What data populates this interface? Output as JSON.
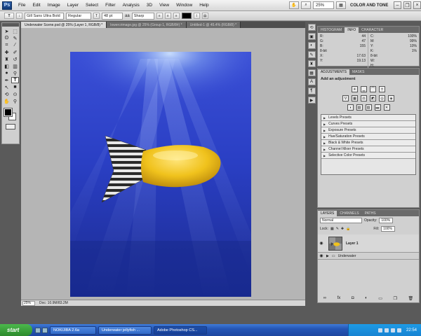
{
  "menubar": {
    "logo": "Ps",
    "items": [
      "File",
      "Edit",
      "Image",
      "Layer",
      "Select",
      "Filter",
      "Analysis",
      "3D",
      "View",
      "Window",
      "Help"
    ],
    "zoom": "25%",
    "workspace": "COLOR AND TONE"
  },
  "options": {
    "tool_icon": "T",
    "font_family": "Gill Sans Ultra Bold",
    "font_style": "Regular",
    "font_size": "48 pt",
    "aa_label": "aa",
    "antialias": "Sharp"
  },
  "tabs": [
    "Underwater Scene.psd @ 25% (Layer 1, RGB/8) *",
    "lowercrimage.jpg @ 25% (Group 1, RGB/8#) *",
    "Untitled-1 @ 45.4% (RGB/8) *"
  ],
  "status": {
    "zoom": "25%",
    "doc": "Doc: 10.9M/83.2M"
  },
  "info": {
    "tabs": [
      "HISTOGRAM",
      "INFO",
      "CHARACTER"
    ],
    "rgb": [
      {
        "k": "R:",
        "v": "44"
      },
      {
        "k": "G:",
        "v": "47"
      },
      {
        "k": "B:",
        "v": "155"
      }
    ],
    "rgb_mode": "8-bit",
    "xy": [
      {
        "k": "X:",
        "v": "17.63"
      },
      {
        "k": "Y:",
        "v": "19.13"
      }
    ],
    "cmyk": [
      {
        "k": "C:",
        "v": "100%"
      },
      {
        "k": "M:",
        "v": "99%"
      },
      {
        "k": "Y:",
        "v": "10%"
      },
      {
        "k": "K:",
        "v": "1%"
      }
    ],
    "cmyk_mode": "8-bit",
    "wh": [
      {
        "k": "W:",
        "v": ""
      },
      {
        "k": "H:",
        "v": ""
      }
    ]
  },
  "adjustments": {
    "tabs": [
      "ADJUSTMENTS",
      "MASKS"
    ],
    "title": "Add an adjustment",
    "presets": [
      "Levels Presets",
      "Curves Presets",
      "Exposure Presets",
      "Hue/Saturation Presets",
      "Black & White Presets",
      "Channel Mixer Presets",
      "Selective Color Presets"
    ]
  },
  "layers": {
    "tabs": [
      "LAYERS",
      "CHANNELS",
      "PATHS"
    ],
    "blend_mode": "Normal",
    "opacity_label": "Opacity:",
    "opacity": "100%",
    "lock_label": "Lock:",
    "fill_label": "Fill:",
    "fill": "100%",
    "items": [
      {
        "name": "Layer 1"
      },
      {
        "name": "Underwater"
      }
    ]
  },
  "taskbar": {
    "start": "start",
    "tasks": [
      "NOKIJIBA 2.6a",
      "Underwater jellyfish ...",
      "Adobe Photoshop CS..."
    ],
    "time": "22:54"
  }
}
